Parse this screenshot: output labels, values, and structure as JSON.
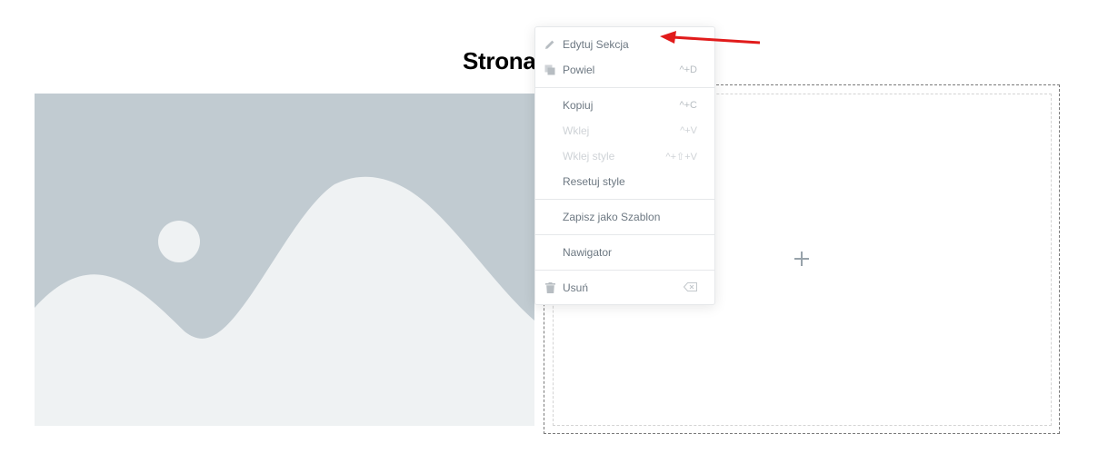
{
  "page": {
    "title": "Strona"
  },
  "colors": {
    "image_background": "#c1cbd1",
    "image_foreground": "#eff2f3",
    "menu_text": "#6d7882",
    "menu_disabled_text": "#cfd3d7",
    "annotation_arrow": "#e11b1b"
  },
  "context_menu": {
    "items": [
      {
        "label": "Edytuj Sekcja",
        "shortcut": "",
        "icon": "pencil-icon",
        "enabled": true
      },
      {
        "label": "Powiel",
        "shortcut": "^+D",
        "icon": "copy-icon",
        "enabled": true
      },
      {
        "label": "Kopiuj",
        "shortcut": "^+C",
        "icon": "",
        "enabled": true
      },
      {
        "label": "Wklej",
        "shortcut": "^+V",
        "icon": "",
        "enabled": false
      },
      {
        "label": "Wklej style",
        "shortcut": "^+⇧+V",
        "icon": "",
        "enabled": false
      },
      {
        "label": "Resetuj style",
        "shortcut": "",
        "icon": "",
        "enabled": true
      },
      {
        "label": "Zapisz jako Szablon",
        "shortcut": "",
        "icon": "",
        "enabled": true
      },
      {
        "label": "Nawigator",
        "shortcut": "",
        "icon": "",
        "enabled": true
      },
      {
        "label": "Usuń",
        "shortcut": "",
        "icon": "trash-icon",
        "enabled": true,
        "shortcut_icon": "delete-key-icon"
      }
    ]
  },
  "section": {
    "add_icon": "plus-icon"
  }
}
